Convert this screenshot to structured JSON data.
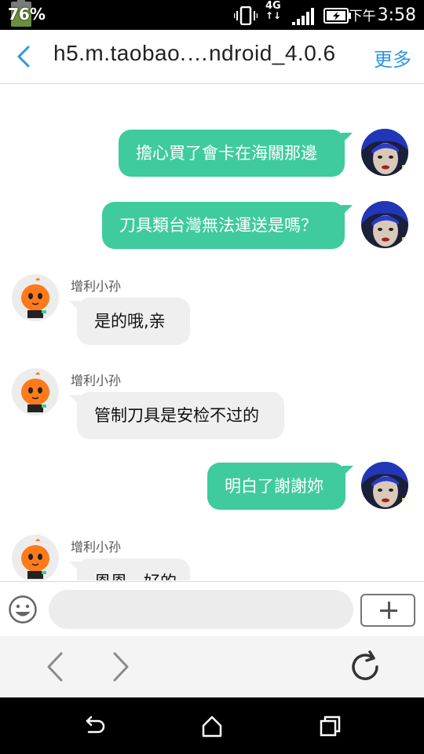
{
  "status_bar": {
    "battery_percent": "76%",
    "battery_level": 0.76,
    "network": "4G",
    "time_prefix": "下午",
    "time": "3:58"
  },
  "header": {
    "title": "h5.m.taobao.…ndroid_4.0.6",
    "more_label": "更多",
    "accent_color": "#2f96e0"
  },
  "messages": [
    {
      "side": "out",
      "text": "擔心買了會卡在海關那邊"
    },
    {
      "side": "out",
      "text": "刀具類台灣無法運送是嗎？"
    },
    {
      "side": "in",
      "sender": "增利小孙",
      "text": "是的哦,亲"
    },
    {
      "side": "in",
      "sender": "增利小孙",
      "text": "管制刀具是安检不过的"
    },
    {
      "side": "out",
      "text": "明白了謝謝妳"
    },
    {
      "side": "in",
      "sender": "增利小孙",
      "text": "恩恩，好的"
    }
  ],
  "colors": {
    "outgoing_bubble": "#3fcb9e",
    "incoming_bubble": "#efefef"
  },
  "input": {
    "placeholder": ""
  },
  "icons": {
    "back": "chevron-left-icon",
    "emoji": "smiley-icon",
    "add": "plus-icon",
    "browser_back": "chevron-left-icon",
    "browser_forward": "chevron-right-icon",
    "refresh": "refresh-icon",
    "sys_back": "android-back-icon",
    "sys_home": "android-home-icon",
    "sys_recents": "android-recents-icon"
  }
}
